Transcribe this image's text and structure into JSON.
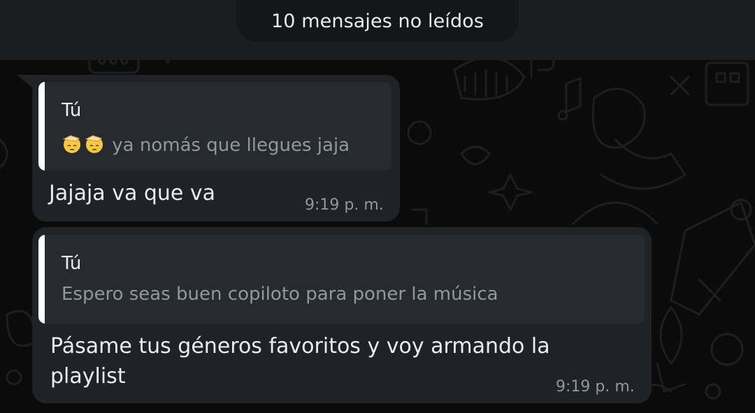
{
  "unread_banner": {
    "text": "10 mensajes no leídos"
  },
  "messages": [
    {
      "quote": {
        "author": "Tú",
        "emojis": [
          "saluting-face-emoji",
          "saluting-face-emoji"
        ],
        "text": "ya nomás que llegues jaja"
      },
      "text": "Jajaja va que va",
      "time": "9:19 p. m."
    },
    {
      "quote": {
        "author": "Tú",
        "text": "Espero seas buen copiloto para poner la música"
      },
      "text_line_1": "Pásame tus géneros favoritos y voy armando la",
      "text_line_2": "playlist",
      "time": "9:19 p. m."
    }
  ],
  "colors": {
    "background": "#0b0b0b",
    "banner_band": "#1b1d1f",
    "bubble": "#1f2226",
    "quote_box": "#272b30",
    "quote_bar": "#ffffff",
    "text_primary": "#e9edef",
    "text_secondary": "#8f989e"
  }
}
